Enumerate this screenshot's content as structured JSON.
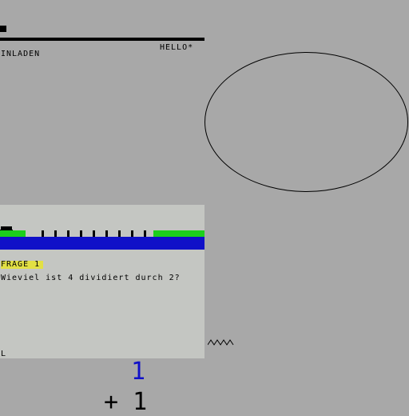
{
  "header": {
    "greeting": "HELLO*",
    "loading_label": "INLADEN"
  },
  "quiz": {
    "question_tag": "FRAGE 1",
    "question_text": "Wieviel ist 4 dividiert durch 2?",
    "input_prompt": "L"
  },
  "bottom": {
    "answer_value": "1",
    "plus_label": "+ 1"
  },
  "colors": {
    "background": "#a8a8a8",
    "panel": "#c4c6c2",
    "grass": "#1ccf1c",
    "water": "#1010c8",
    "highlight": "#e2e044",
    "answer": "#1010c8"
  },
  "icons": {
    "tank": "tank-icon",
    "bridge_posts": "bridge-post-icon",
    "zigzag": "zigzag-icon"
  }
}
